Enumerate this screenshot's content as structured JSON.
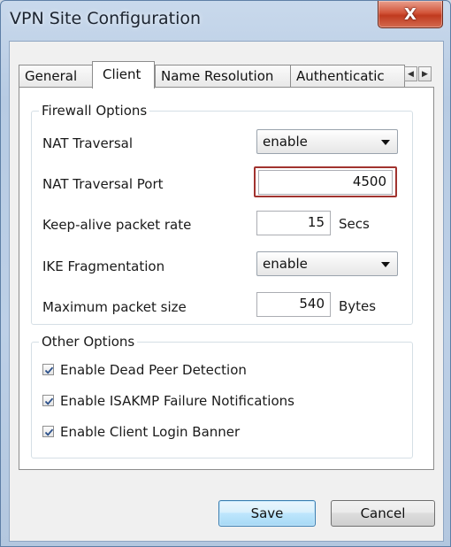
{
  "window": {
    "title": "VPN Site Configuration",
    "close_glyph": "X"
  },
  "tabs": [
    {
      "label": "General"
    },
    {
      "label": "Client"
    },
    {
      "label": "Name Resolution"
    },
    {
      "label": "Authenticatic"
    }
  ],
  "tab_scroll": {
    "left_icon": "triangle-left-icon",
    "right_icon": "triangle-right-icon"
  },
  "firewall": {
    "title": "Firewall Options",
    "nat_traversal": {
      "label": "NAT Traversal",
      "value": "enable"
    },
    "nat_traversal_port": {
      "label": "NAT Traversal Port",
      "value": "4500"
    },
    "keepalive": {
      "label": "Keep-alive packet rate",
      "value": "15",
      "unit": "Secs"
    },
    "ike_fragmentation": {
      "label": "IKE Fragmentation",
      "value": "enable"
    },
    "max_packet": {
      "label": "Maximum packet size",
      "value": "540",
      "unit": "Bytes"
    }
  },
  "other": {
    "title": "Other Options",
    "options": [
      {
        "label": "Enable Dead Peer Detection",
        "checked": true
      },
      {
        "label": "Enable ISAKMP Failure Notifications",
        "checked": true
      },
      {
        "label": "Enable Client Login Banner",
        "checked": true
      }
    ]
  },
  "buttons": {
    "save": "Save",
    "cancel": "Cancel"
  },
  "colors": {
    "highlight_border": "#a1332f",
    "close_button": "#c03a1f",
    "default_button": "#3c7fb1"
  }
}
